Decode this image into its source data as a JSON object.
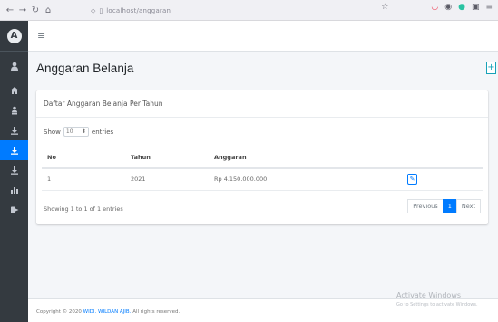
{
  "browser": {
    "url": "localhost/anggaran",
    "back_icon": "arrow-left",
    "forward_icon": "arrow-right",
    "reload_icon": "reload",
    "home_icon": "home"
  },
  "sidebar": {
    "brand_letter": "A",
    "items": [
      {
        "icon": "user-icon"
      },
      {
        "icon": "home-icon"
      },
      {
        "icon": "users-icon"
      },
      {
        "icon": "download-icon"
      },
      {
        "icon": "download-icon",
        "active": true
      },
      {
        "icon": "download-icon"
      },
      {
        "icon": "chart-icon"
      },
      {
        "icon": "logout-icon"
      }
    ]
  },
  "topnav": {
    "menu_icon": "≡"
  },
  "page": {
    "title": "Anggaran Belanja",
    "add_label": "+"
  },
  "card": {
    "title": "Daftar Anggaran Belanja Per Tahun",
    "show_label": "Show",
    "entries_label": "entries",
    "page_length": "10",
    "columns": [
      "No",
      "Tahun",
      "Anggaran",
      ""
    ],
    "rows": [
      {
        "no": "1",
        "tahun": "2021",
        "anggaran": "Rp 4.150.000.000"
      }
    ],
    "info": "Showing 1 to 1 of 1 entries",
    "pagination": {
      "previous": "Previous",
      "current": "1",
      "next": "Next"
    }
  },
  "footer": {
    "copyright": "Copyright © 2020 ",
    "brand": "WIDI. WILDAN AJIB.",
    "rights": " All rights reserved."
  },
  "watermark": {
    "title": "Activate Windows",
    "subtitle": "Go to Settings to activate Windows."
  },
  "colors": {
    "sidebar": "#343a40",
    "accent": "#007bff",
    "info": "#17a2b8"
  }
}
